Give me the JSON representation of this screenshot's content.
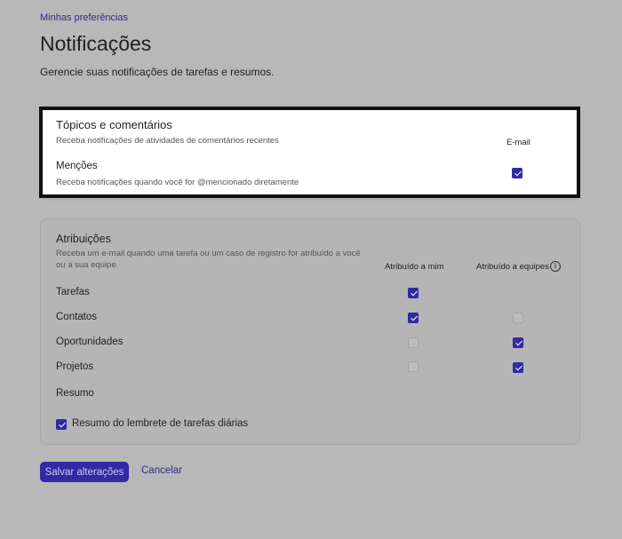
{
  "breadcrumb": "Minhas preferências",
  "header": {
    "title": "Notificações",
    "subtitle": "Gerencie suas notificações de tarefas e resumos."
  },
  "topics": {
    "title": "Tópicos e comentários",
    "description": "Receba notificações de atividades de comentários recentes",
    "column_email": "E-mail",
    "mentions": {
      "title": "Menções",
      "description": "Receba notificações quando você for @mencionado diretamente",
      "email_checked": true
    }
  },
  "assignments": {
    "title": "Atribuições",
    "description_line1": "Receba um e-mail quando uma tarefa ou um caso de registro for atribuído a você",
    "description_line2": "ou à sua equipe.",
    "col_me": "Atribuído a mim",
    "col_teams": "Atribuído a equipes",
    "info_icon": "info-icon",
    "rows": [
      {
        "label": "Tarefas",
        "me": true,
        "teams": null
      },
      {
        "label": "Contatos",
        "me": true,
        "teams": false
      },
      {
        "label": "Oportunidades",
        "me": false,
        "teams": true
      },
      {
        "label": "Projetos",
        "me": false,
        "teams": true
      }
    ],
    "summary_title": "Resumo",
    "summary_option": {
      "label": "Resumo do lembrete de tarefas diárias",
      "checked": true
    }
  },
  "actions": {
    "save": "Salvar alterações",
    "cancel": "Cancelar"
  },
  "colors": {
    "accent": "#312aa3",
    "link": "#2d2a8c",
    "overlay_bg": "#b8b8b8"
  }
}
